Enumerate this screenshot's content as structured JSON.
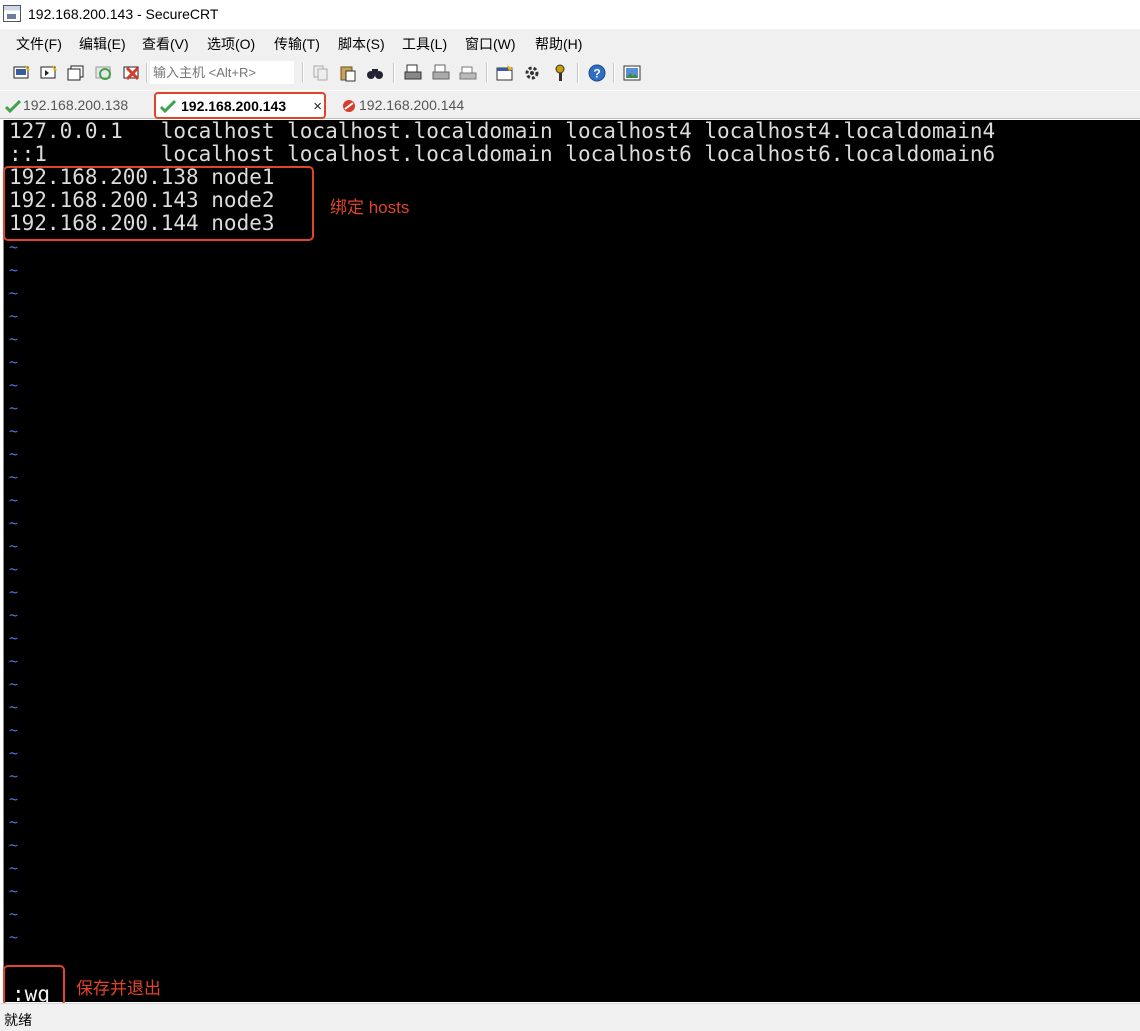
{
  "window": {
    "title": "192.168.200.143 - SecureCRT"
  },
  "menu": {
    "items": [
      "文件(F)",
      "编辑(E)",
      "查看(V)",
      "选项(O)",
      "传输(T)",
      "脚本(S)",
      "工具(L)",
      "窗口(W)",
      "帮助(H)"
    ]
  },
  "toolbar": {
    "quick_connect_placeholder": "输入主机 <Alt+R>",
    "icons": [
      "connect-icon",
      "quick-connect-icon",
      "connect-tab-icon",
      "reconnect-icon",
      "disconnect-icon",
      "copy-icon",
      "paste-icon",
      "find-icon",
      "print-icon",
      "print-selection-icon",
      "printer-setup-icon",
      "session-options-icon",
      "global-options-icon",
      "keymap-icon",
      "help-icon",
      "screenshot-icon"
    ]
  },
  "tabs": [
    {
      "label": "192.168.200.138",
      "status": "connected",
      "active": false
    },
    {
      "label": "192.168.200.143",
      "status": "connected",
      "active": true,
      "close": "×"
    },
    {
      "label": "192.168.200.144",
      "status": "disconnected",
      "active": false
    }
  ],
  "terminal": {
    "lines": [
      "127.0.0.1   localhost localhost.localdomain localhost4 localhost4.localdomain4",
      "::1         localhost localhost.localdomain localhost6 localhost6.localdomain6",
      "192.168.200.138 node1",
      "192.168.200.143 node2",
      "192.168.200.144 node3"
    ],
    "empty_line_marker": "~",
    "empty_line_count": 31,
    "command": ":wq"
  },
  "annotations": {
    "hosts": "绑定 hosts",
    "save": "保存并退出"
  },
  "status": {
    "text": "就绪"
  },
  "colors": {
    "annotation": "#e0452a",
    "tilde": "#4e74d8",
    "terminal_bg": "#000000",
    "terminal_fg": "#dcdcdc",
    "connected": "#3fa34d",
    "disconnected": "#d43c2c"
  }
}
